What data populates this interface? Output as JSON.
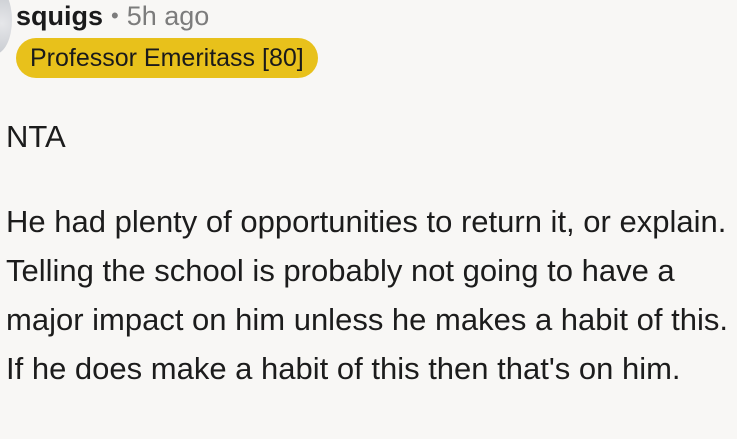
{
  "comment": {
    "author": "squigs",
    "separator": "•",
    "timestamp": "5h ago",
    "flair": "Professor Emeritass [80]",
    "paragraphs": [
      "NTA",
      "He had plenty of opportunities to return it, or explain. Telling the school is probably not going to have a major impact on him unless he makes a habit of this. If he does make a habit of this then that's on him."
    ]
  },
  "colors": {
    "flair_background": "#e8c11b",
    "page_background": "#f8f7f5",
    "meta_text": "#7c7c7c"
  }
}
